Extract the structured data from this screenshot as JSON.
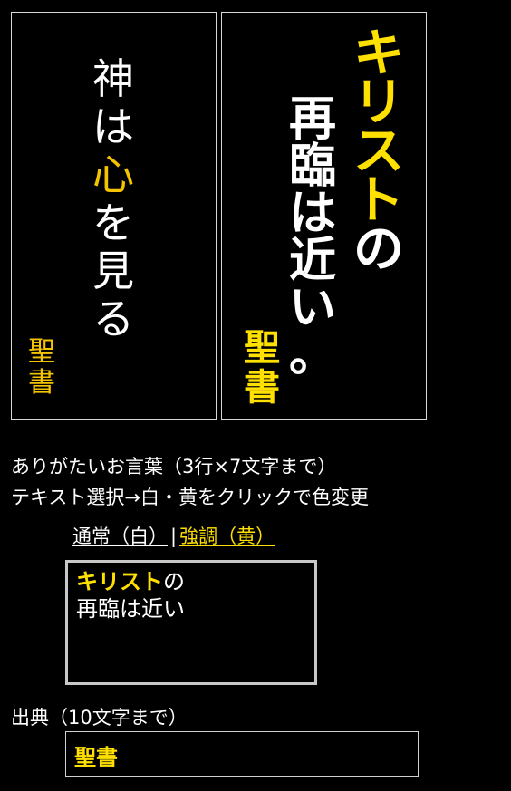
{
  "card_left": {
    "quote_chars": [
      "神",
      "は",
      "心",
      "を",
      "見",
      "る"
    ],
    "highlight_index": 2,
    "source_chars": [
      "聖",
      "書"
    ]
  },
  "card_right": {
    "line1_chars": [
      "キ",
      "リ",
      "ス",
      "ト",
      "の"
    ],
    "line1_yellow_count": 4,
    "line2_chars": [
      "再",
      "臨",
      "は",
      "近",
      "い",
      "。"
    ],
    "source_chars": [
      "聖",
      "書"
    ]
  },
  "instructions": {
    "line1": "ありがたいお言葉（3行×7文字まで）",
    "line2": "テキスト選択→白・黄をクリックで色変更"
  },
  "style_buttons": {
    "normal": "通常（白）",
    "separator": "|",
    "emphasis": "強調（黄）"
  },
  "editor": {
    "line1_emphasis": "キリスト",
    "line1_rest": "の",
    "line2": "再臨は近い"
  },
  "source": {
    "label": "出典（10文字まで）",
    "value": "聖書"
  },
  "colors": {
    "background": "#000000",
    "text": "#ffffff",
    "emphasis": "#ffe000",
    "gold": "#f5c400"
  }
}
